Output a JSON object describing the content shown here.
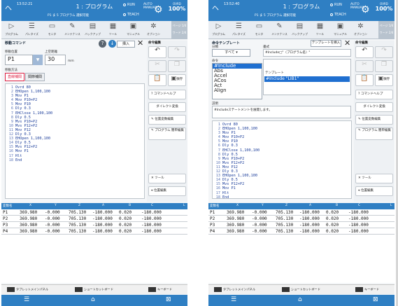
{
  "colors": {
    "accent": "#2f7fc3",
    "selection": "#1f6fd0"
  },
  "screens": [
    {
      "status": {
        "back": "ヘ",
        "clock": "13:52:21",
        "title": "1 : プログラム",
        "subtitle": "P1  ま  5   プログラム 選択可能",
        "run": "RUN",
        "teach": "TEACH",
        "auto": "AUTO MANUAL",
        "ovrd_label": "OVRD",
        "ovrd_value": "100%"
      },
      "toolbar": [
        "プログラム",
        "パレタイズ",
        "モニタ",
        "メンテナンス",
        "バックアップ",
        "ツール",
        "マニュアル",
        "オプション"
      ],
      "right_toolbar": [
        "命令 編集",
        "ページ 1/4",
        "ワード 2/4"
      ],
      "panel_title": "移動コマンド",
      "help": "?",
      "insert_button": "挿入",
      "close": "✕",
      "side_header": "命令編集",
      "fields": {
        "target_label": "移動位置",
        "target_value": "P1",
        "distance_label": "上空距離",
        "distance_value": "30",
        "distance_unit": "mm",
        "method_label": "移動方法",
        "tab_joint": "直線補間",
        "tab_linear": "関節補間"
      },
      "side_buttons": [
        "元に戻す",
        "やり直し",
        "切り取り",
        "コピー",
        "貼り付け",
        "保存",
        "コマンドヘルプ",
        "ダイレクト変換",
        "位置変数編集",
        "プログラム 簡単編集",
        "ツール",
        "位置編集"
      ],
      "code": [
        "Ovrd 80",
        "EHOpen 1,100,100",
        "Mov P1",
        "Mov P10+P2",
        "Mov P10",
        "Dly 0.3",
        "EHClose 1,100,100",
        "Dly 0.5",
        "Mvs P10+P2",
        "Mvs P12+P2",
        "Mov P12",
        "Dly 0.3",
        "EHOpen 1,100,100",
        "Dly 0.5",
        "Mvs P12+P2",
        "Mov P1",
        "Hlt",
        "End"
      ],
      "bottom": {
        "left": "タブレットメインパネル",
        "center": "ショートカットボード",
        "right": "キーボード"
      }
    },
    {
      "status": {
        "back": "ヘ",
        "clock": "13:52:40",
        "title": "1 : プログラム",
        "subtitle": "P1  ま  5   プログラム 選択可能",
        "run": "RUN",
        "teach": "TEACH",
        "auto": "AUTO MANUAL",
        "ovrd_label": "OVRD",
        "ovrd_value": "100%"
      },
      "toolbar": [
        "プログラム",
        "パレタイズ",
        "モニタ",
        "メンテナンス",
        "バックアップ",
        "ツール",
        "マニュアル",
        "オプション"
      ],
      "right_toolbar": [
        "命令 編集",
        "ページ 1/4",
        "ワード 2/4"
      ],
      "panel_title": "命令テンプレート",
      "template_button": "テンプレートを挿入",
      "close": "✕",
      "side_header": "命令編集",
      "labels": {
        "type": "分類",
        "all": "すべて",
        "format": "書式",
        "format_value": "#Include□\"〈プログラム名〉\"",
        "name": "命令",
        "template": "テンプレート",
        "template_value": "#Include \"LIB1\"",
        "desc": "説明",
        "desc_value": "#Includeステートメントを展開します。"
      },
      "commands": [
        "#Include",
        "Abs",
        "Accel",
        "ACos",
        "Act",
        "Align"
      ],
      "side_buttons": [
        "元に戻す",
        "やり直し",
        "切り取り",
        "コピー",
        "貼り付け",
        "保存",
        "コマンドヘルプ",
        "ダイレクト変換",
        "位置変数編集",
        "プログラム 簡単編集",
        "ツール",
        "位置編集"
      ],
      "code": [
        "Ovrd 80",
        "EHOpen 1,100,100",
        "Mov P1",
        "Mov P10+P2",
        "Mov P10",
        "Dly 0.3",
        "EHClose 1,100,100",
        "Dly 0.5",
        "Mvs P10+P2",
        "Mvs P12+P2",
        "Mov P12",
        "Dly 0.3",
        "EHOpen 1,100,100",
        "Dly 0.5",
        "Mvs P12+P2",
        "Mov P1",
        "Hlt",
        "End"
      ],
      "bottom": {
        "left": "タブレットメインパネル",
        "center": "ショートカットボード",
        "right": "キーボード"
      }
    }
  ],
  "grid": {
    "headers": [
      "変数名",
      "X",
      "Y",
      "Z",
      "A",
      "B",
      "C",
      "L"
    ],
    "rows": [
      [
        "P1",
        "369.980",
        "-0.000",
        "705.130",
        "-180.000",
        "0.020",
        "-180.000"
      ],
      [
        "P2",
        "369.980",
        "-0.000",
        "705.130",
        "-180.000",
        "0.020",
        "-180.000"
      ],
      [
        "P3",
        "369.980",
        "-0.000",
        "705.130",
        "-180.000",
        "0.020",
        "-180.000"
      ],
      [
        "P4",
        "369.980",
        "-0.000",
        "705.130",
        "-180.000",
        "0.020",
        "-180.000"
      ]
    ]
  }
}
